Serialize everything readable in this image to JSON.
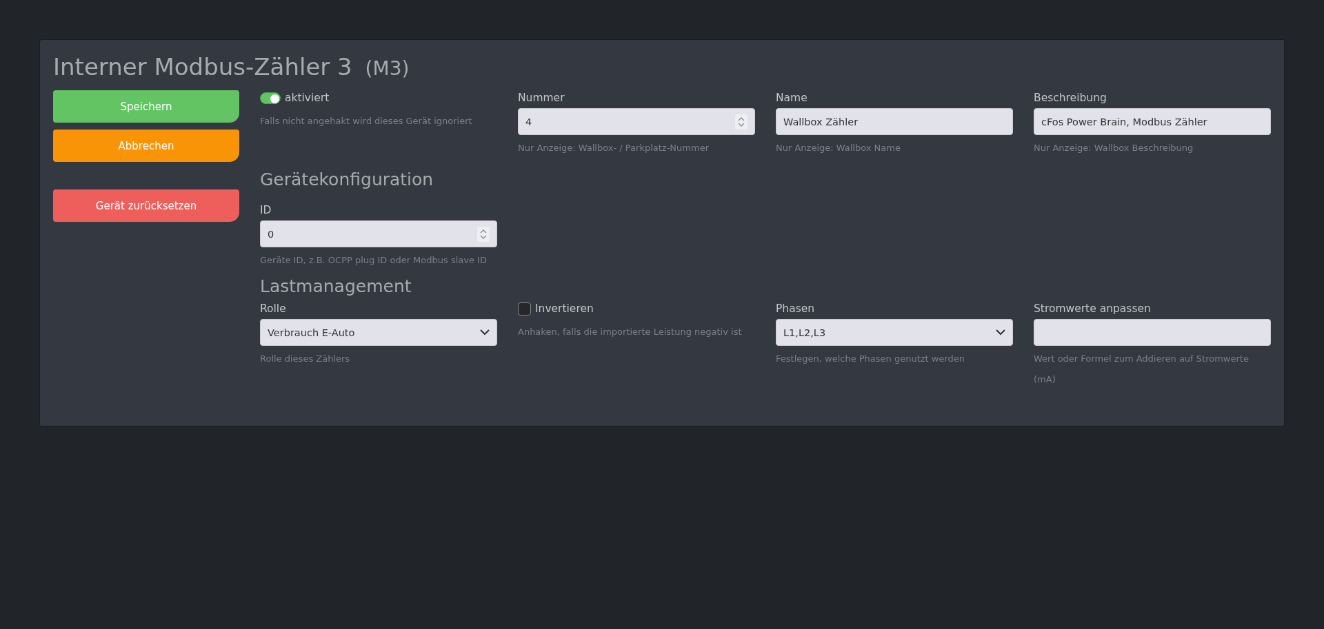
{
  "title": {
    "text": "Interner Modbus-Zähler 3",
    "suffix": "(M3)"
  },
  "buttons": [
    {
      "label": "Speichern",
      "kind": "save"
    },
    {
      "label": "Abbrechen",
      "kind": "cancel"
    },
    {
      "label": "Gerät zurücksetzen",
      "kind": "reset"
    }
  ],
  "sections": [
    {
      "fields": [
        {
          "kind": "toggle",
          "label": "aktiviert",
          "on": true,
          "help": "Falls nicht angehakt wird dieses Gerät ignoriert"
        },
        {
          "kind": "number",
          "label": "Nummer",
          "value": "4",
          "help": "Nur Anzeige: Wallbox- / Parkplatz-Nummer"
        },
        {
          "kind": "text",
          "label": "Name",
          "value": "Wallbox Zähler",
          "help": "Nur Anzeige: Wallbox Name"
        },
        {
          "kind": "text",
          "label": "Beschreibung",
          "value": "cFos Power Brain, Modbus Zähler",
          "help": "Nur Anzeige: Wallbox Beschreibung"
        }
      ]
    },
    {
      "heading": "Gerätekonfiguration",
      "fields": [
        {
          "kind": "number",
          "label": "ID",
          "value": "0",
          "help": "Geräte ID, z.B. OCPP plug ID oder Modbus slave ID"
        }
      ]
    },
    {
      "heading": "Lastmanagement",
      "fields": [
        {
          "kind": "select",
          "label": "Rolle",
          "value": "Verbrauch E-Auto",
          "help": "Rolle dieses Zählers"
        },
        {
          "kind": "checkbox",
          "label": "Invertieren",
          "checked": false,
          "help": "Anhaken, falls die importierte Leistung negativ ist"
        },
        {
          "kind": "select",
          "label": "Phasen",
          "value": "L1,L2,L3",
          "help": "Festlegen, welche Phasen genutzt werden"
        },
        {
          "kind": "text",
          "label": "Stromwerte anpassen",
          "help": "Wert oder Formel zum Addieren auf Stromwerte (mA)"
        }
      ]
    }
  ]
}
